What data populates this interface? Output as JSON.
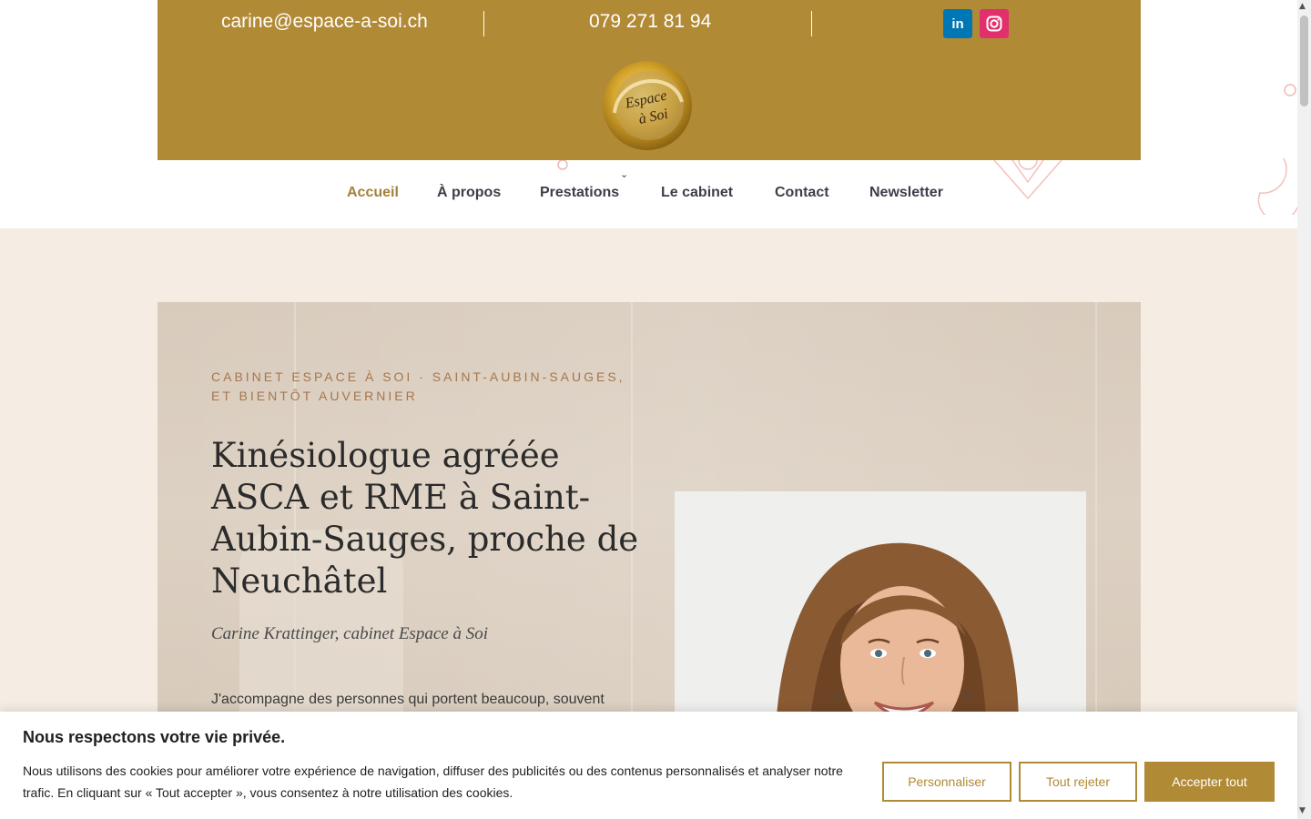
{
  "topbar": {
    "email": "carine@espace-a-soi.ch",
    "phone": "079 271 81 94",
    "social": [
      {
        "name": "linkedin-icon",
        "glyph": "in"
      },
      {
        "name": "instagram-icon"
      }
    ],
    "logo_text": "Espace à Soi",
    "colors": {
      "background": "#b18a36"
    }
  },
  "nav": {
    "items": [
      {
        "label": "Accueil",
        "active": true
      },
      {
        "label": "À propos"
      },
      {
        "label": "Prestations",
        "has_submenu": true
      },
      {
        "label": "Le cabinet"
      },
      {
        "label": "Contact"
      },
      {
        "label": "Newsletter"
      }
    ],
    "colors": {
      "active": "#a5813a",
      "text": "#3c3f4a"
    }
  },
  "hero": {
    "eyebrow": "CABINET ESPACE À SOI · SAINT-AUBIN-SAUGES, ET BIENTÔT AUVERNIER",
    "title": "Kinésiologue agréée ASCA et RME à Saint-Aubin-Sauges, proche de Neuchâtel",
    "subtitle": "Carine Krattinger, cabinet Espace à Soi",
    "intro": "J'accompagne des personnes qui portent beaucoup, souvent"
  },
  "cookie": {
    "title": "Nous respectons votre vie privée.",
    "text": "Nous utilisons des cookies pour améliorer votre expérience de navigation, diffuser des publicités ou des contenus personnalisés et analyser notre trafic. En cliquant sur « Tout accepter », vous consentez à notre utilisation des cookies.",
    "buttons": {
      "customize": "Personnaliser",
      "reject": "Tout rejeter",
      "accept": "Accepter tout"
    },
    "colors": {
      "accent": "#b18a36"
    }
  }
}
